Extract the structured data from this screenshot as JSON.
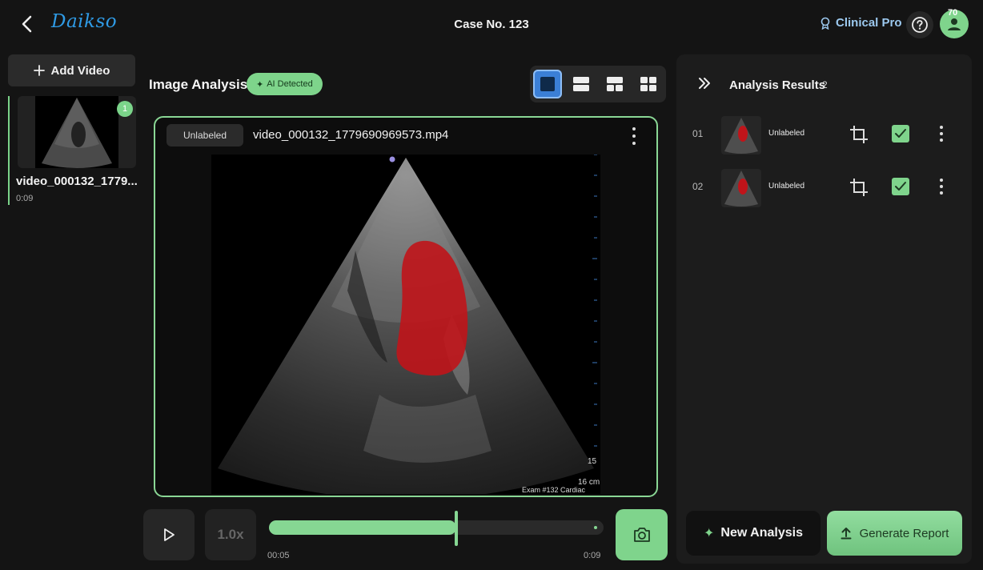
{
  "header": {
    "logo_text": "Daikso",
    "case_title": "Case No. 123",
    "plan_label": "Clinical Pro",
    "avatar_badge": "70"
  },
  "sidebar": {
    "add_video_label": "Add Video",
    "videos": [
      {
        "name": "video_000132_1779...",
        "duration": "0:09",
        "badge": "1"
      }
    ]
  },
  "analysis": {
    "title": "Image Analysis",
    "ai_badge": "AI Detected",
    "label_chip": "Unlabeled",
    "file_name": "video_000132_1779690969573.mp4",
    "depth_value": "15",
    "depth_unit": "16 cm",
    "exam_label": "Exam #132 Cardiac"
  },
  "playback": {
    "speed": "1.0x",
    "current_time": "00:05",
    "total_time": "0:09",
    "progress": 0.56
  },
  "results": {
    "title": "Analysis Results",
    "count": "2",
    "rows": [
      {
        "number": "01",
        "label": "Unlabeled"
      },
      {
        "number": "02",
        "label": "Unlabeled"
      }
    ],
    "new_analysis_label": "New Analysis",
    "generate_report_label": "Generate Report"
  },
  "colors": {
    "accent_green": "#7fd48c",
    "logo_blue": "#2f9be6",
    "overlay_red": "#c0141a"
  }
}
